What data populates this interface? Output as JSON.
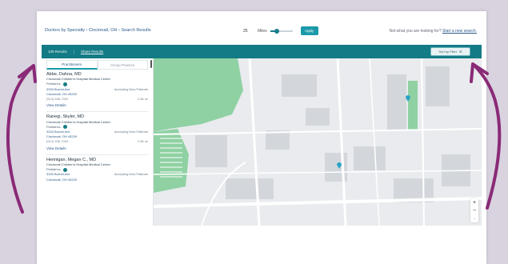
{
  "search": {
    "breadcrumb": "Doctors by Specialty › Cincinnati, OH › Search Results",
    "radius_value": "25",
    "radius_unit": "Miles",
    "radius_level": 0.3,
    "apply_label": "Apply",
    "prompt_text": "Not what you are looking for?",
    "prompt_link": "Start a new search."
  },
  "results_bar": {
    "count_label": "109 Results",
    "share_label": "Share Results",
    "sort_label": "Sort by Filter"
  },
  "panel": {
    "tabs": [
      {
        "label": "Practitioners",
        "active": true
      },
      {
        "label": "Group Practice",
        "active": false
      }
    ],
    "results": [
      {
        "name": "Abbe, Dahna, MD",
        "hospital": "Cincinnati Children's Hospital Medical Center",
        "specialty": "Pediatrics",
        "address1": "3333 Burnet Ave",
        "address2": "Cincinnati, OH 45229",
        "accepting": "Accepting New Patients",
        "phone": "(513) 636-7000",
        "distance": "2.86 mi",
        "view_label": "View Details"
      },
      {
        "name": "Ranegi, Skyler, MD",
        "hospital": "Cincinnati Children's Hospital Medical Center",
        "specialty": "Pediatrics",
        "address1": "3333 Burnet Ave",
        "address2": "Cincinnati, OH 45229",
        "accepting": "Accepting New Patients",
        "phone": "(513) 636-7000",
        "distance": "2.86 mi",
        "view_label": "View Details"
      },
      {
        "name": "Hennigan, Megan C., MD",
        "hospital": "Cincinnati Children's Hospital Medical Center",
        "specialty": "Pediatrics",
        "address1": "3333 Burnet Ave",
        "address2": "Cincinnati, OH 45229",
        "accepting": "Accepting New Patients",
        "phone": "",
        "distance": "",
        "view_label": ""
      }
    ]
  },
  "map": {
    "zoom_in": "+",
    "zoom_out": "−",
    "pin_color": "#2aa3c4",
    "park_color": "#8fd1a3"
  },
  "colors": {
    "teal": "#137b85",
    "accent": "#1a9aa8",
    "arrow": "#8a2a77"
  }
}
